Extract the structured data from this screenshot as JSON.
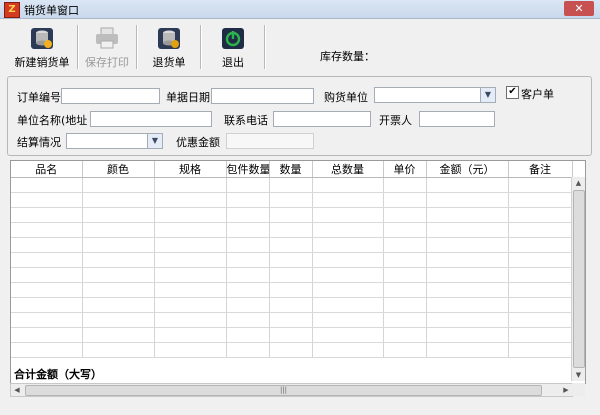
{
  "window": {
    "title": "销货单窗口",
    "close_glyph": "✕"
  },
  "toolbar": {
    "buttons": [
      {
        "label": "新建销货单",
        "icon": "db-add-icon",
        "disabled": false
      },
      {
        "label": "保存打印",
        "icon": "printer-icon",
        "disabled": true
      },
      {
        "label": "退货单",
        "icon": "db-return-icon",
        "disabled": false
      },
      {
        "label": "退出",
        "icon": "power-icon",
        "disabled": false
      }
    ],
    "stock_label": "库存数量："
  },
  "form": {
    "order_no": {
      "label": "订单编号",
      "value": ""
    },
    "doc_date": {
      "label": "单据日期",
      "value": ""
    },
    "buyer_unit": {
      "label": "购货单位",
      "value": ""
    },
    "customer_check": {
      "label": "客户单",
      "checked": true
    },
    "unit_name": {
      "label": "单位名称(地址",
      "value": ""
    },
    "phone": {
      "label": "联系电话",
      "value": ""
    },
    "invoicer": {
      "label": "开票人",
      "value": ""
    },
    "settlement": {
      "label": "结算情况",
      "value": ""
    },
    "discount": {
      "label": "优惠金额",
      "value": ""
    }
  },
  "grid": {
    "columns": [
      "品名",
      "颜色",
      "规格",
      "包件数量",
      "数量",
      "总数量",
      "单价",
      "金额（元）",
      "备注"
    ],
    "row_count": 12,
    "total_label": "合计金额（大写）"
  },
  "colors": {
    "title_bg": "#c9d8ec",
    "close_btn": "#c75050",
    "power_green": "#2bb24c"
  }
}
